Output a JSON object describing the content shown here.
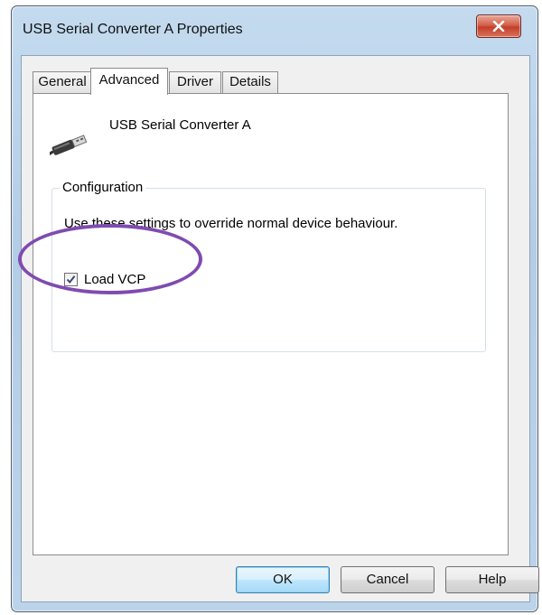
{
  "window": {
    "title": "USB Serial Converter A Properties"
  },
  "tabs": [
    {
      "label": "General",
      "active": false
    },
    {
      "label": "Advanced",
      "active": true
    },
    {
      "label": "Driver",
      "active": false
    },
    {
      "label": "Details",
      "active": false
    }
  ],
  "device": {
    "name": "USB Serial Converter A",
    "icon": "usb-plug-icon"
  },
  "configuration": {
    "group_label": "Configuration",
    "description": "Use these settings to override normal device behaviour.",
    "load_vcp": {
      "label": "Load VCP",
      "checked": true
    }
  },
  "buttons": {
    "ok": "OK",
    "cancel": "Cancel",
    "help": "Help"
  },
  "colors": {
    "highlight_ring": "#7f4bb0",
    "close_button": "#c33f2a"
  }
}
